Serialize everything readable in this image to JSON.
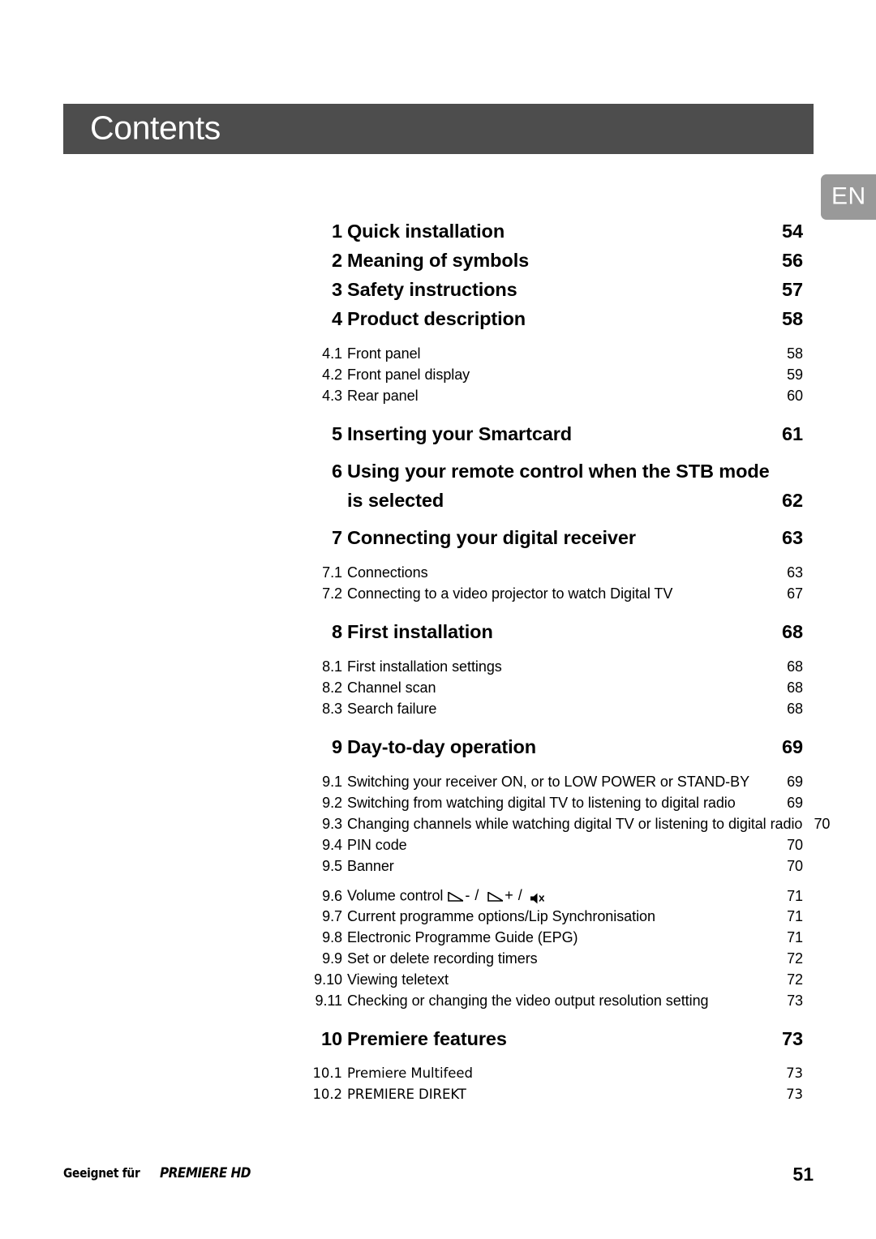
{
  "header": {
    "title": "Contents",
    "bar_color": "#4d4d4d",
    "title_color": "#ffffff"
  },
  "language_tab": {
    "label": "EN",
    "background_color": "#999999",
    "text_color": "#ffffff"
  },
  "toc": {
    "entries": [
      {
        "level": 1,
        "number": "1",
        "label": "Quick installation",
        "page": "54"
      },
      {
        "level": 1,
        "number": "2",
        "label": "Meaning of symbols",
        "page": "56"
      },
      {
        "level": 1,
        "number": "3",
        "label": "Safety instructions",
        "page": "57"
      },
      {
        "level": 1,
        "number": "4",
        "label": "Product description",
        "page": "58"
      },
      {
        "level": 2,
        "number": "4.1",
        "label": "Front panel",
        "page": "58"
      },
      {
        "level": 2,
        "number": "4.2",
        "label": "Front panel display",
        "page": "59"
      },
      {
        "level": 2,
        "number": "4.3",
        "label": "Rear panel",
        "page": "60"
      },
      {
        "level": 1,
        "number": "5",
        "label": "Inserting your Smartcard",
        "page": "61"
      },
      {
        "level": 1,
        "number": "6",
        "label": "Using your remote control when the STB mode",
        "page": ""
      },
      {
        "level": 1,
        "number": "",
        "label": "is selected",
        "page": "62"
      },
      {
        "level": 1,
        "number": "7",
        "label": "Connecting your digital receiver",
        "page": "63"
      },
      {
        "level": 2,
        "number": "7.1",
        "label": "Connections",
        "page": "63"
      },
      {
        "level": 2,
        "number": "7.2",
        "label": "Connecting to a video projector to watch Digital TV",
        "page": "67"
      },
      {
        "level": 1,
        "number": "8",
        "label": "First installation",
        "page": "68"
      },
      {
        "level": 2,
        "number": "8.1",
        "label": "First installation settings",
        "page": "68"
      },
      {
        "level": 2,
        "number": "8.2",
        "label": "Channel scan",
        "page": "68"
      },
      {
        "level": 2,
        "number": "8.3",
        "label": "Search failure",
        "page": "68"
      },
      {
        "level": 1,
        "number": "9",
        "label": "Day-to-day operation",
        "page": "69"
      },
      {
        "level": 2,
        "number": "9.1",
        "label": "Switching your receiver ON, or to LOW POWER or STAND-BY",
        "page": "69"
      },
      {
        "level": 2,
        "number": "9.2",
        "label": "Switching from watching digital TV to listening to digital radio",
        "page": "69"
      },
      {
        "level": 2,
        "number": "9.3",
        "label": "Changing channels while watching digital TV or listening to digital radio",
        "page": "70"
      },
      {
        "level": 2,
        "number": "9.4",
        "label": "PIN code",
        "page": "70"
      },
      {
        "level": 2,
        "number": "9.5",
        "label": "Banner",
        "page": "70"
      },
      {
        "level": 2,
        "number": "9.6",
        "label": "Volume control",
        "page": "71",
        "icons": true
      },
      {
        "level": 2,
        "number": "9.7",
        "label": "Current programme options/Lip Synchronisation",
        "page": "71"
      },
      {
        "level": 2,
        "number": "9.8",
        "label": "Electronic Programme Guide (EPG)",
        "page": "71"
      },
      {
        "level": 2,
        "number": "9.9",
        "label": "Set or delete recording timers",
        "page": "72"
      },
      {
        "level": 2,
        "number": "9.10",
        "label": "Viewing teletext",
        "page": "72"
      },
      {
        "level": 2,
        "number": "9.11",
        "label": "Checking or changing the video output resolution setting",
        "page": "73"
      },
      {
        "level": 1,
        "number": "10",
        "label": "Premiere features",
        "page": "73"
      },
      {
        "level": 2,
        "number": "10.1",
        "label": "Premiere Multifeed",
        "page": "73"
      },
      {
        "level": 2,
        "number": "10.2",
        "label": "PREMIERE DIREKT",
        "page": "73"
      }
    ],
    "volume_row": {
      "volume_down_sign": "-",
      "volume_up_sign": "+",
      "separator": "/",
      "icon_names": [
        "volume-down-icon",
        "volume-up-icon",
        "mute-icon"
      ]
    }
  },
  "footer": {
    "brand_prefix": "Geeignet für",
    "brand_logo": "PREMIERE HD",
    "page_number": "51"
  }
}
